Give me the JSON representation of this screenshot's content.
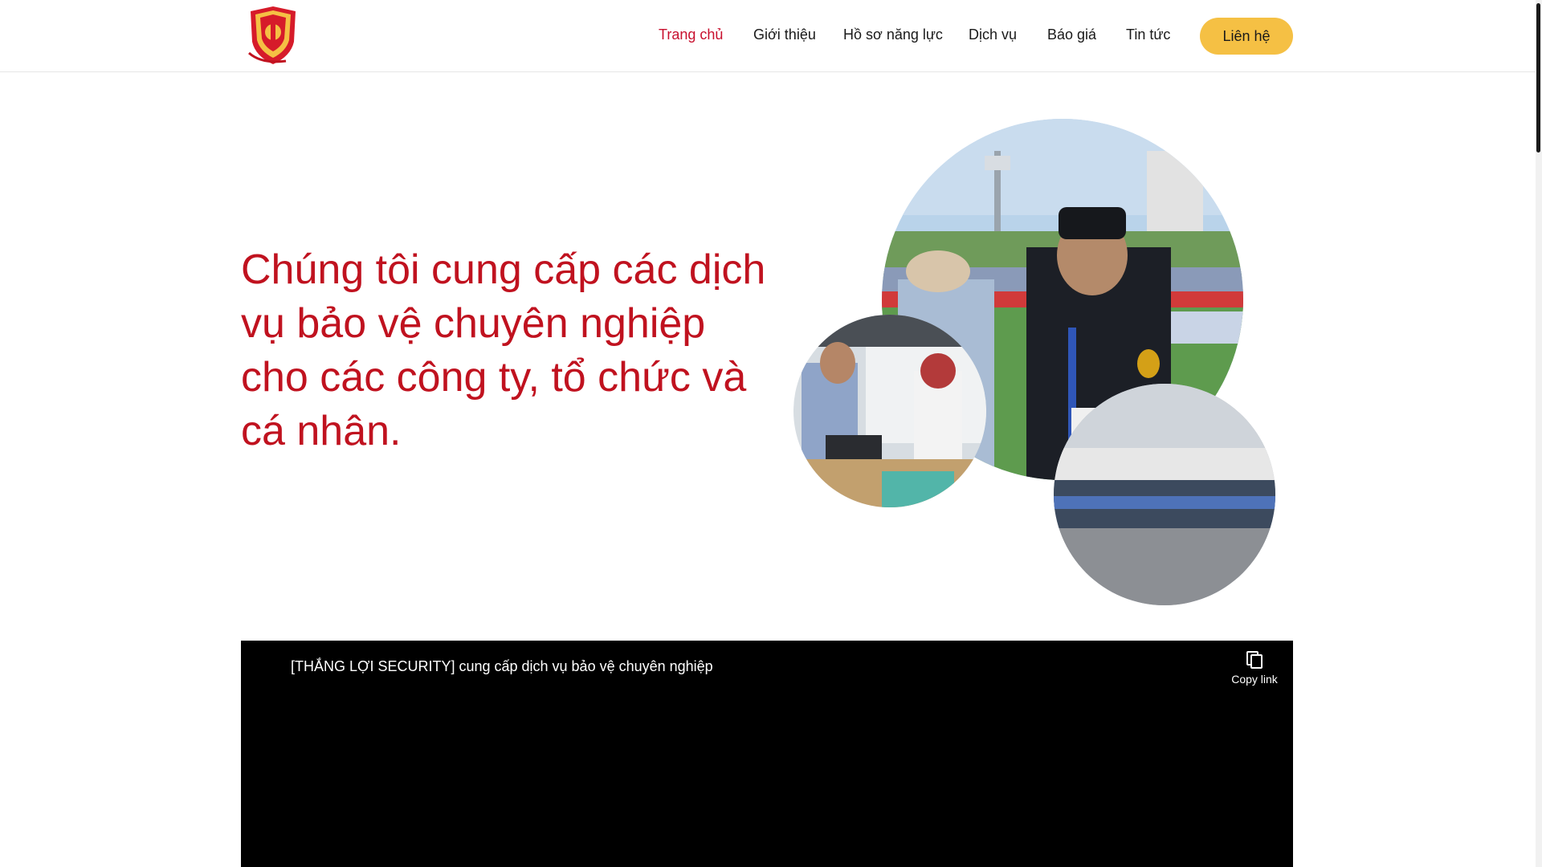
{
  "header": {
    "nav": [
      {
        "label": "Trang chủ",
        "active": true
      },
      {
        "label": "Giới thiệu",
        "active": false
      },
      {
        "label": "Hồ sơ năng lực",
        "active": false
      },
      {
        "label": "Dịch vụ",
        "active": false
      },
      {
        "label": "Báo giá",
        "active": false
      },
      {
        "label": "Tin tức",
        "active": false
      }
    ],
    "cta_label": "Liên hệ"
  },
  "hero": {
    "headline": "Chúng tôi cung cấp các dịch vụ bảo vệ chuyên nghiệp cho các công ty, tổ chức và cá nhân."
  },
  "video": {
    "title": "[THẮNG LỢI SECURITY] cung cấp dịch vụ bảo vệ chuyên nghiệp",
    "copy_label": "Copy link"
  },
  "colors": {
    "brand_red": "#c0121f",
    "nav_active": "#c8102e",
    "cta_yellow": "#f5c044",
    "video_bg": "#000000"
  },
  "icons": [
    "shield-logo",
    "copy-icon"
  ]
}
